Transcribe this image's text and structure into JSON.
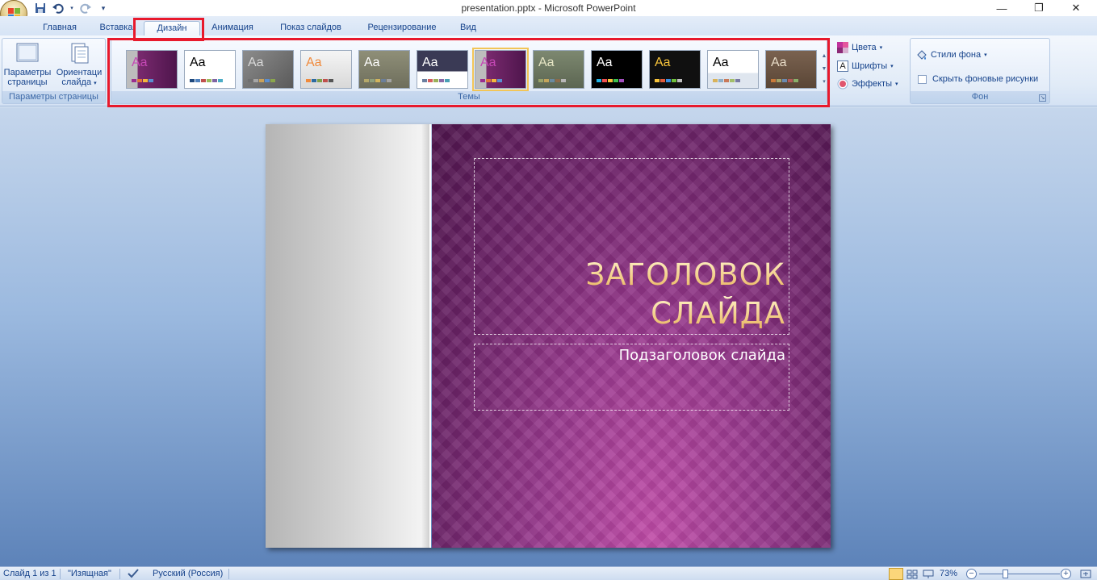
{
  "window": {
    "title": "presentation.pptx - Microsoft PowerPoint"
  },
  "qat": {
    "save_icon": "save-icon",
    "undo_icon": "undo-icon",
    "redo_icon": "redo-icon",
    "customize_icon": "customize-qat-icon"
  },
  "tabs": [
    {
      "label": "Главная"
    },
    {
      "label": "Вставка"
    },
    {
      "label": "Дизайн"
    },
    {
      "label": "Анимация"
    },
    {
      "label": "Показ слайдов"
    },
    {
      "label": "Рецензирование"
    },
    {
      "label": "Вид"
    }
  ],
  "active_tab": "Дизайн",
  "ribbon": {
    "page_setup": {
      "label": "Параметры страницы",
      "page_params_button": "Параметры страницы",
      "page_params_line1": "Параметры",
      "page_params_line2": "страницы",
      "orientation_line1": "Ориентаци",
      "orientation_line2": "слайда"
    },
    "themes": {
      "label": "Темы",
      "items": [
        {
          "sample": "Aa",
          "text_color": "#c548b5",
          "colors": [
            "#9b2e8f",
            "#e1743c",
            "#f3b73d",
            "#5a8ed0"
          ]
        },
        {
          "sample": "Aa",
          "text_color": "#000000",
          "colors": [
            "#1f497d",
            "#4f81bd",
            "#c0504d",
            "#9bbb59",
            "#8064a2",
            "#4bacc6"
          ]
        },
        {
          "sample": "Aa",
          "text_color": "#d9d9d9",
          "colors": [
            "#6f6f6f",
            "#a5a5a5",
            "#c9a15a",
            "#5a8ed0",
            "#8aa64c"
          ]
        },
        {
          "sample": "Aa",
          "text_color": "#f08a3c",
          "colors": [
            "#f08a3c",
            "#2c6aa0",
            "#7fa04a",
            "#c0504d",
            "#555555"
          ]
        },
        {
          "sample": "Aa",
          "text_color": "#ffffff",
          "colors": [
            "#b5a86a",
            "#8e9f7c",
            "#d2b45d",
            "#6b7f9a",
            "#a3a3a3"
          ]
        },
        {
          "sample": "Aa",
          "text_color": "#ffffff",
          "colors": [
            "#6b7fa0",
            "#d55e5e",
            "#9bb05a",
            "#8a6aa8",
            "#4aa0b5"
          ]
        },
        {
          "sample": "Aa",
          "text_color": "#c548b5",
          "colors": [
            "#9b2e8f",
            "#e1743c",
            "#f3b73d",
            "#5a8ed0"
          ]
        },
        {
          "sample": "Aa",
          "text_color": "#e7e6c5",
          "colors": [
            "#9aa36a",
            "#c3a45a",
            "#6a8aa0",
            "#8c6a4a",
            "#b8b8b8"
          ]
        },
        {
          "sample": "Aa",
          "text_color": "#ffffff",
          "colors": [
            "#1fb3e6",
            "#f04f4f",
            "#f7c33b",
            "#3bbf4f",
            "#a34fbf"
          ]
        },
        {
          "sample": "Aa",
          "text_color": "#f7c33b",
          "colors": [
            "#f7c33b",
            "#e05b3b",
            "#3b8fe0",
            "#6fbf3b",
            "#bfbfbf"
          ]
        },
        {
          "sample": "Aa",
          "text_color": "#000000",
          "colors": [
            "#d9b35a",
            "#8fb0c9",
            "#c97a5a",
            "#a3bf6a",
            "#7a7aa3"
          ]
        },
        {
          "sample": "Aa",
          "text_color": "#e8dcc8",
          "colors": [
            "#c97a3b",
            "#a3a36a",
            "#6a8ab0",
            "#b55a5a",
            "#8ab06a"
          ]
        }
      ]
    },
    "theme_options": {
      "colors": "Цвета",
      "fonts": "Шрифты",
      "effects": "Эффекты"
    },
    "background": {
      "label": "Фон",
      "styles": "Стили фона",
      "hide_graphics": "Скрыть фоновые рисунки"
    }
  },
  "slide": {
    "title_line1": "ЗАГОЛОВОК",
    "title_line2": "СЛАЙДА",
    "subtitle": "Подзаголовок слайда"
  },
  "status": {
    "slide_info": "Слайд 1 из 1",
    "theme_name": "\"Изящная\"",
    "language": "Русский (Россия)",
    "zoom": "73%"
  }
}
